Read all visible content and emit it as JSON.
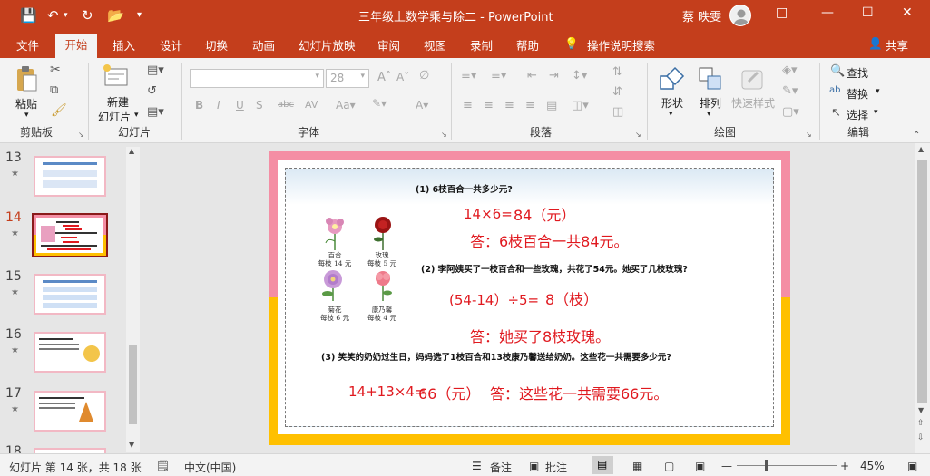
{
  "title_bar": {
    "document_title": "三年级上数学乘与除二  -  PowerPoint",
    "user_name": "蔡 昳雯",
    "quick_access": [
      "save-icon",
      "undo-icon",
      "redo-icon",
      "open-icon",
      "customize-icon"
    ]
  },
  "ribbon_tabs": [
    "文件",
    "开始",
    "插入",
    "设计",
    "切换",
    "动画",
    "幻灯片放映",
    "审阅",
    "视图",
    "录制",
    "帮助"
  ],
  "active_tab": "开始",
  "tell_me": "操作说明搜索",
  "share": "共享",
  "ribbon": {
    "clipboard": {
      "paste": "粘贴",
      "group": "剪贴板"
    },
    "slides": {
      "new_slide_line1": "新建",
      "new_slide_line2": "幻灯片",
      "group": "幻灯片"
    },
    "font": {
      "font_name": "",
      "font_size": "28",
      "group": "字体"
    },
    "paragraph": {
      "group": "段落"
    },
    "drawing": {
      "shapes": "形状",
      "arrange": "排列",
      "quick_styles": "快速样式",
      "group": "绘图"
    },
    "editing": {
      "find": "查找",
      "replace": "替换",
      "select": "选择",
      "group": "编辑"
    }
  },
  "thumbnails": [
    {
      "num": "13",
      "selected": false
    },
    {
      "num": "14",
      "selected": true
    },
    {
      "num": "15",
      "selected": false
    },
    {
      "num": "16",
      "selected": false
    },
    {
      "num": "17",
      "selected": false
    },
    {
      "num": "18",
      "selected": false
    }
  ],
  "slide": {
    "q1": "(1)  6枝百合一共多少元?",
    "a1_expr": "14×6=",
    "a1_result": "84（元）",
    "a1_answer": "答：6枝百合一共84元。",
    "q2": "(2)  李阿姨买了一枝百合和一些玫瑰，共花了54元。她买了几枝玫瑰?",
    "a2_expr": "(54-14）÷5=",
    "a2_result": "8（枝）",
    "a2_answer": "答：她买了8枝玫瑰。",
    "q3": "(3)  笑笑的奶奶过生日，妈妈选了1枝百合和13枝康乃馨送给奶奶。这些花一共需要多少元?",
    "a3_expr": "14+13×4=",
    "a3_result": "66（元）",
    "a3_answer": "答：这些花一共需要66元。",
    "flowers": [
      {
        "name": "百合",
        "price": "每枝 14 元"
      },
      {
        "name": "玫瑰",
        "price": "每枝 5 元"
      },
      {
        "name": "菊花",
        "price": "每枝 6 元"
      },
      {
        "name": "康乃馨",
        "price": "每枝 4 元"
      }
    ]
  },
  "status_bar": {
    "slide_info": "幻灯片 第 14 张，共 18 张",
    "language": "中文(中国)",
    "notes": "备注",
    "comments": "批注",
    "zoom": "45%"
  },
  "colors": {
    "accent": "#c43e1c",
    "answer_red": "#e0191f",
    "slide_pink": "#f48ea4",
    "slide_yellow": "#ffc000"
  }
}
